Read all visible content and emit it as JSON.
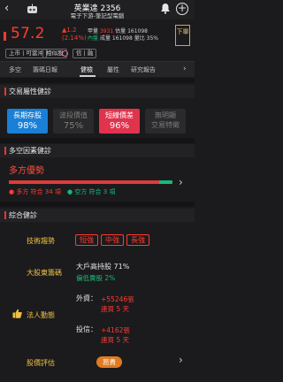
{
  "header": {
    "title": "英業達 2356",
    "subtitle": "電子下游-筆記型電腦"
  },
  "quote": {
    "price": "57.2",
    "change": "▲1.2",
    "change_pct": "(2.14%)",
    "stats_line1": [
      "甲量",
      "3931",
      "估量",
      "161098"
    ],
    "stats_line2": [
      "內盤",
      "成量",
      "161098",
      "量比",
      "35%"
    ],
    "buy_label": "下單"
  },
  "tags": {
    "market": "上市 | 可當沖",
    "margin": "信 | 融",
    "sector": "相似股"
  },
  "tabs": [
    "多空",
    "籌碼日報",
    "健檢",
    "屬性",
    "研究報告"
  ],
  "active_tab_index": 2,
  "sections": {
    "attributes": "交易屬性健診",
    "bullbear": "多空因素健診",
    "health": "綜合健診"
  },
  "attributes": [
    {
      "label": "長期存股",
      "value": "98%",
      "style": "blue"
    },
    {
      "label": "波段價值",
      "value": "75%",
      "style": "dim"
    },
    {
      "label": "短線價差",
      "value": "96%",
      "style": "pink"
    },
    {
      "label": "無明顯",
      "value": "交易特徵",
      "style": "dim"
    }
  ],
  "bullbear": {
    "title": "多方優勢",
    "bull_count_text": "● 多方 符合 34 項",
    "bear_count_text": "● 空方 符合 3 項",
    "bull_count": 34,
    "bear_count": 3
  },
  "health": {
    "trend_label": "技術趨勢",
    "trend_pills": [
      "短強",
      "中強",
      "長強"
    ],
    "holders_label": "大股東籌碼",
    "holders_line1": "大戶高持股 71%",
    "holders_line2": "偏低賣股 2%",
    "institution_label": "法人動態",
    "foreign_label": "外資：",
    "foreign_value": "+55246張",
    "foreign_days": "連買 5 天",
    "trust_label": "投信：",
    "trust_value": "+4162張",
    "trust_days": "連買 5 天",
    "valuation_label": "股價評估",
    "valuation_value": "昂貴"
  },
  "colors": {
    "up": "#ff3b30",
    "down": "#17b978",
    "gold": "#f0c040",
    "blue": "#1a7fd6",
    "pink": "#e0334d"
  }
}
